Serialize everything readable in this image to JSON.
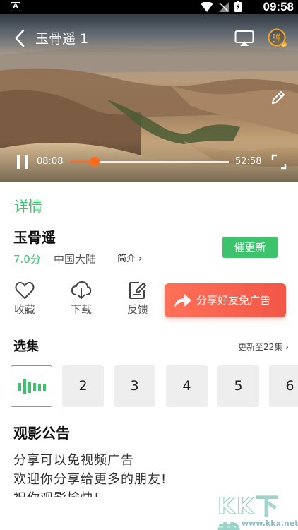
{
  "status_bar": {
    "badge": "A",
    "time": "09:58"
  },
  "player": {
    "title": "玉骨遥 1",
    "current_time": "08:08",
    "total_time": "52:58",
    "progress": 0.15,
    "danmaku_label": "弹",
    "icons": [
      "back-icon",
      "cast-icon",
      "danmaku-icon",
      "edit-icon",
      "pause-icon",
      "fullscreen-icon"
    ]
  },
  "detail": {
    "tab_label": "详情",
    "title": "玉骨遥",
    "rating": "7.0分",
    "region": "中国大陆",
    "intro_label": "简介 ›",
    "remind_button": "催更新"
  },
  "actions": [
    {
      "icon": "heart-icon",
      "label": "收藏"
    },
    {
      "icon": "download-icon",
      "label": "下载"
    },
    {
      "icon": "feedback-icon",
      "label": "反馈"
    }
  ],
  "share_button": "分享好友免广告",
  "episodes": {
    "title": "选集",
    "update_info": "更新至22集 ›",
    "items": [
      "",
      "2",
      "3",
      "4",
      "5",
      "6"
    ]
  },
  "notice": {
    "title": "观影公告",
    "lines": [
      "分享可以免视频广告",
      "欢迎你分享给更多的朋友!",
      "祝你观影愉快!"
    ]
  },
  "watermark": {
    "text": "KK下载",
    "url": "www.kkx.net"
  },
  "colors": {
    "accent_green": "#3cc36c",
    "progress_orange": "#ff6a1e",
    "share_red": "#f25647"
  }
}
